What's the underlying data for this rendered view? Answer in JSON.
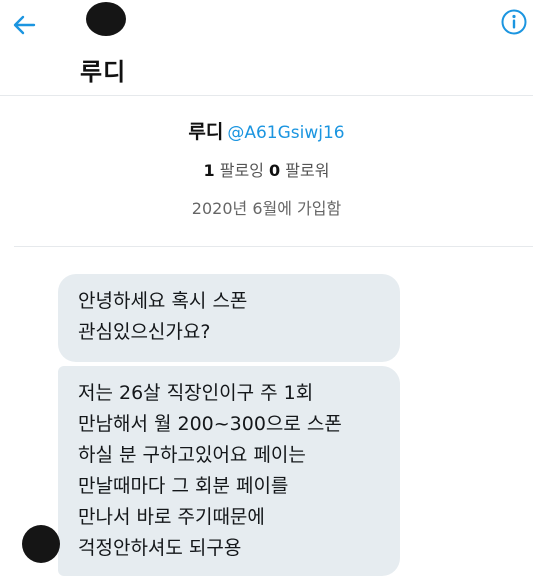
{
  "header": {
    "title": "루디",
    "back_icon": "arrow-left-icon",
    "info_icon": "info-circle-icon"
  },
  "profile": {
    "name": "루디",
    "handle": "@A61Gsiwj16",
    "following_count": "1",
    "following_label": "팔로잉",
    "followers_count": "0",
    "followers_label": "팔로워",
    "joined": "2020년 6월에 가입함"
  },
  "messages": [
    {
      "lines": [
        "안녕하세요 혹시 스폰",
        "관심있으신가요?"
      ]
    },
    {
      "lines": [
        "저는 26살 직장인이구 주 1회",
        "만남해서 월 200~300으로 스폰",
        "하실 분 구하고있어요 페이는",
        "만날때마다 그 회분 페이를",
        "만나서 바로 주기때문에",
        "걱정안하셔도 되구용"
      ]
    }
  ],
  "colors": {
    "accent": "#1b95e0",
    "bubble": "#e6ecf0",
    "avatar_redaction": "#151515"
  }
}
